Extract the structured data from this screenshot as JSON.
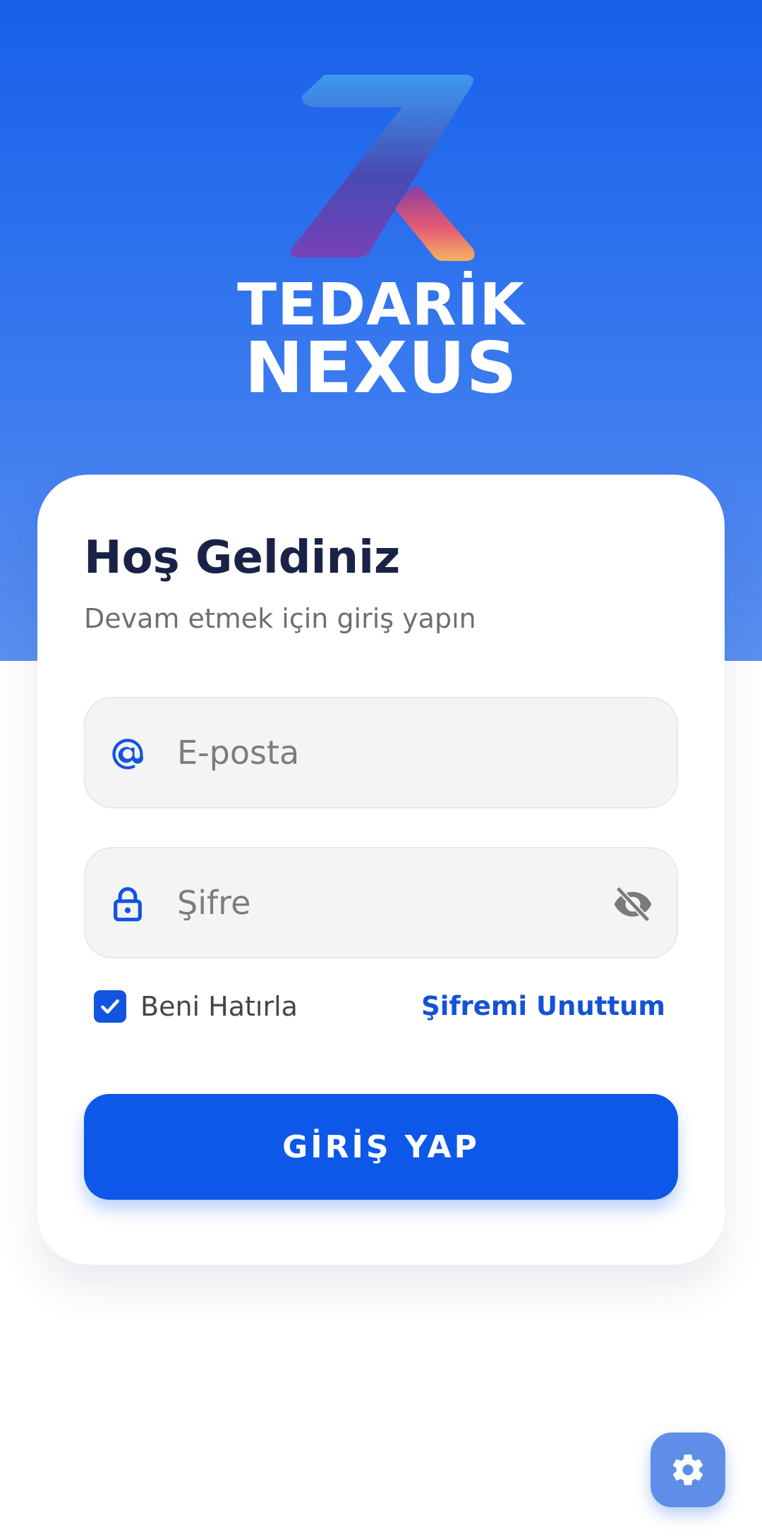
{
  "brand": {
    "line1": "TEDARİK",
    "line2": "NEXUS"
  },
  "login": {
    "title": "Hoş Geldiniz",
    "subtitle": "Devam etmek için giriş yapın",
    "email_placeholder": "E-posta",
    "email_value": "",
    "email_icon": "at-icon",
    "password_placeholder": "Şifre",
    "password_value": "",
    "password_icon": "lock-icon",
    "password_toggle_icon": "eye-off-icon",
    "remember_label": "Beni Hatırla",
    "remember_checked": true,
    "forgot_label": "Şifremi Unuttum",
    "submit_label": "GİRİŞ YAP"
  },
  "settings": {
    "icon": "gear-icon"
  },
  "colors": {
    "primary": "#0d58e8",
    "hero_top": "#1760ea",
    "hero_bottom": "#5b8ff0",
    "title_text": "#1a2347",
    "link": "#1452d6",
    "field_bg": "#f4f4f4",
    "fab_bg": "#5f8ee9"
  }
}
